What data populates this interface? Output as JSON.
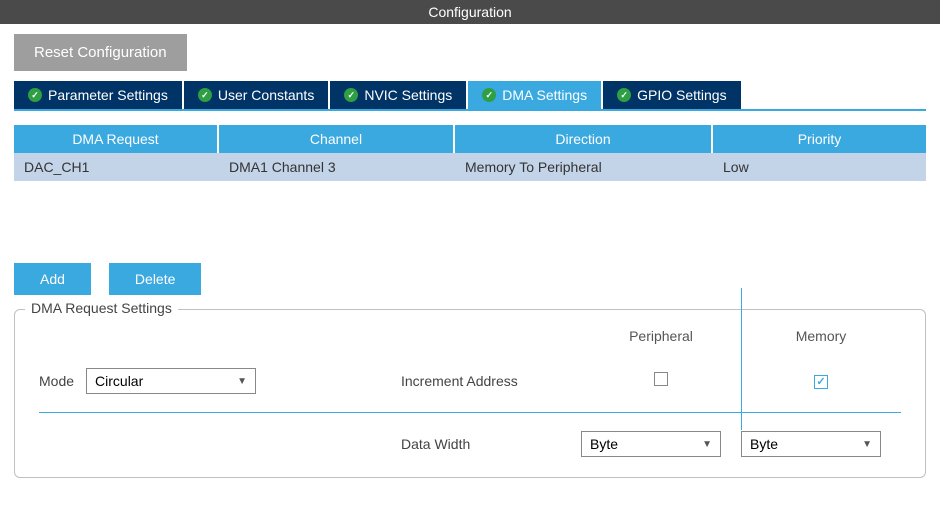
{
  "header": {
    "title": "Configuration"
  },
  "toolbar": {
    "reset_label": "Reset Configuration"
  },
  "tabs": [
    {
      "label": "Parameter Settings",
      "active": false
    },
    {
      "label": "User Constants",
      "active": false
    },
    {
      "label": "NVIC Settings",
      "active": false
    },
    {
      "label": "DMA Settings",
      "active": true
    },
    {
      "label": "GPIO Settings",
      "active": false
    }
  ],
  "table": {
    "headers": {
      "request": "DMA Request",
      "channel": "Channel",
      "direction": "Direction",
      "priority": "Priority"
    },
    "rows": [
      {
        "request": "DAC_CH1",
        "channel": "DMA1 Channel 3",
        "direction": "Memory To Peripheral",
        "priority": "Low"
      }
    ]
  },
  "buttons": {
    "add": "Add",
    "delete": "Delete"
  },
  "settings": {
    "legend": "DMA Request Settings",
    "col_peripheral": "Peripheral",
    "col_memory": "Memory",
    "mode_label": "Mode",
    "mode_value": "Circular",
    "increment_label": "Increment Address",
    "increment_peripheral_checked": false,
    "increment_memory_checked": true,
    "data_width_label": "Data Width",
    "data_width_peripheral": "Byte",
    "data_width_memory": "Byte"
  }
}
